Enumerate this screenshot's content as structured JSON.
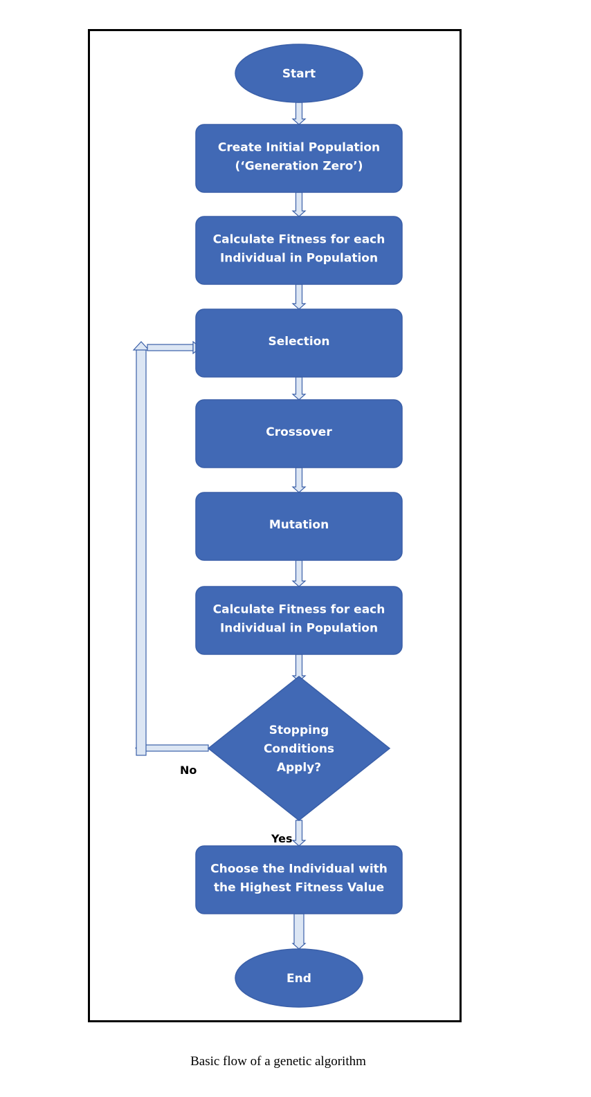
{
  "colors": {
    "node_fill": "#4169B5",
    "node_stroke": "#3A5FA8",
    "arrow_fill": "#DCE6F4",
    "arrow_stroke": "#3A5FA8",
    "node_text": "#FFFFFF"
  },
  "diagram": {
    "nodes": [
      {
        "id": "start",
        "shape": "ellipse",
        "lines": [
          "Start"
        ]
      },
      {
        "id": "create-population",
        "shape": "rect",
        "lines": [
          "Create Initial Population",
          "(‘Generation Zero’)"
        ]
      },
      {
        "id": "calculate-fitness-1",
        "shape": "rect",
        "lines": [
          "Calculate Fitness for each",
          "Individual in Population"
        ]
      },
      {
        "id": "selection",
        "shape": "rect",
        "lines": [
          "Selection"
        ]
      },
      {
        "id": "crossover",
        "shape": "rect",
        "lines": [
          "Crossover"
        ]
      },
      {
        "id": "mutation",
        "shape": "rect",
        "lines": [
          "Mutation"
        ]
      },
      {
        "id": "calculate-fitness-2",
        "shape": "rect",
        "lines": [
          "Calculate Fitness for each",
          "Individual in Population"
        ]
      },
      {
        "id": "stopping-decision",
        "shape": "diamond",
        "lines": [
          "Stopping",
          "Conditions",
          "Apply?"
        ]
      },
      {
        "id": "choose-best",
        "shape": "rect",
        "lines": [
          "Choose the Individual with",
          "the Highest Fitness Value"
        ]
      },
      {
        "id": "end",
        "shape": "ellipse",
        "lines": [
          "End"
        ]
      }
    ],
    "edges": [
      {
        "from": "start",
        "to": "create-population",
        "label": ""
      },
      {
        "from": "create-population",
        "to": "calculate-fitness-1",
        "label": ""
      },
      {
        "from": "calculate-fitness-1",
        "to": "selection",
        "label": ""
      },
      {
        "from": "selection",
        "to": "crossover",
        "label": ""
      },
      {
        "from": "crossover",
        "to": "mutation",
        "label": ""
      },
      {
        "from": "mutation",
        "to": "calculate-fitness-2",
        "label": ""
      },
      {
        "from": "calculate-fitness-2",
        "to": "stopping-decision",
        "label": ""
      },
      {
        "from": "stopping-decision",
        "to": "selection",
        "label": "No"
      },
      {
        "from": "stopping-decision",
        "to": "choose-best",
        "label": "Yes"
      },
      {
        "from": "choose-best",
        "to": "end",
        "label": ""
      }
    ],
    "labels": {
      "no": "No",
      "yes": "Yes"
    }
  },
  "caption": "Basic flow of a genetic algorithm"
}
